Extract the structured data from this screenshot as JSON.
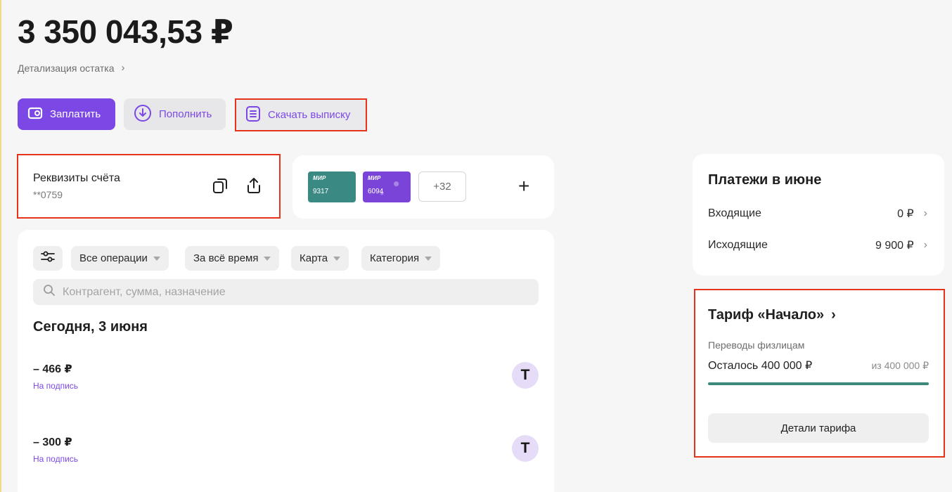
{
  "balance": "3 350 043,53 ₽",
  "balance_details_label": "Детализация остатка",
  "actions": {
    "pay_label": "Заплатить",
    "topup_label": "Пополнить",
    "statement_label": "Скачать выписку"
  },
  "requisites": {
    "title": "Реквизиты счёта",
    "account_mask": "**0759"
  },
  "cards": {
    "items": [
      {
        "brand": "МИР",
        "last4": "9317",
        "color": "#3a8a83"
      },
      {
        "brand": "МИР",
        "last4": "6094",
        "color": "#7b44d8"
      }
    ],
    "more_label": "+32",
    "add_label": "+"
  },
  "filters": {
    "all_operations": "Все операции",
    "period": "За всё время",
    "card": "Карта",
    "category": "Категория"
  },
  "search": {
    "placeholder": "Контрагент, сумма, назначение"
  },
  "operations": {
    "day_title": "Сегодня, 3 июня",
    "items": [
      {
        "amount": "– 466 ₽",
        "subtitle": "На подпись",
        "logo": "T"
      },
      {
        "amount": "– 300 ₽",
        "subtitle": "На подпись",
        "logo": "T"
      }
    ]
  },
  "payments": {
    "title": "Платежи в июне",
    "incoming_label": "Входящие",
    "incoming_value": "0 ₽",
    "outgoing_label": "Исходящие",
    "outgoing_value": "9 900 ₽"
  },
  "tariff": {
    "title": "Тариф «Начало»",
    "subtitle": "Переводы физлицам",
    "remaining": "Осталось 400 000 ₽",
    "limit": "из 400 000 ₽",
    "remaining_fraction": 1.0,
    "details_button": "Детали тарифа"
  },
  "colors": {
    "accent": "#7b48e6",
    "highlight_frame": "#e8331c",
    "progress": "#3d8a7c"
  }
}
